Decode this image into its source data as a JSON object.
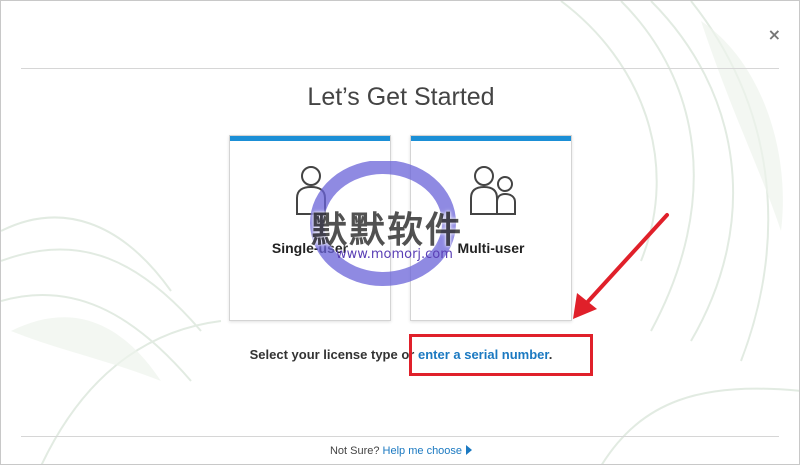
{
  "dialog": {
    "close_label": "×",
    "title": "Let’s Get Started"
  },
  "cards": [
    {
      "label": "Single-user",
      "icon": "single-user-icon"
    },
    {
      "label": "Multi-user",
      "icon": "multi-user-icon"
    }
  ],
  "prompt": {
    "text": "Select your license type or ",
    "link": "enter a serial number",
    "suffix": "."
  },
  "footer": {
    "text": "Not Sure?",
    "link": "Help me choose"
  },
  "watermark": {
    "text": "默默软件",
    "url": "www.momorj.com"
  },
  "colors": {
    "accent": "#1b8fd6",
    "link": "#1b79c1",
    "highlight": "#e0202a"
  }
}
